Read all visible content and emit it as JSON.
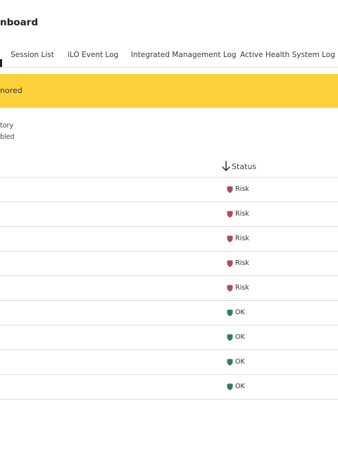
{
  "header": {
    "title": "nboard"
  },
  "tabs": [
    {
      "label": "Session List"
    },
    {
      "label": "iLO Event Log"
    },
    {
      "label": "Integrated Management Log"
    },
    {
      "label": "Active Health System Log"
    }
  ],
  "banner": {
    "text": "nored",
    "color": "#fdd13b"
  },
  "info": {
    "line1": "tory",
    "line2": "bled"
  },
  "table": {
    "columns": [
      {
        "label": "Status",
        "sort": "descending"
      }
    ],
    "rows": [
      {
        "status": "Risk"
      },
      {
        "status": "Risk"
      },
      {
        "status": "Risk"
      },
      {
        "status": "Risk"
      },
      {
        "status": "Risk"
      },
      {
        "status": "OK"
      },
      {
        "status": "OK"
      },
      {
        "status": "OK"
      },
      {
        "status": "OK"
      }
    ]
  },
  "colors": {
    "risk": "#b14b55",
    "ok": "#2c7d66",
    "banner": "#fdd13b"
  }
}
